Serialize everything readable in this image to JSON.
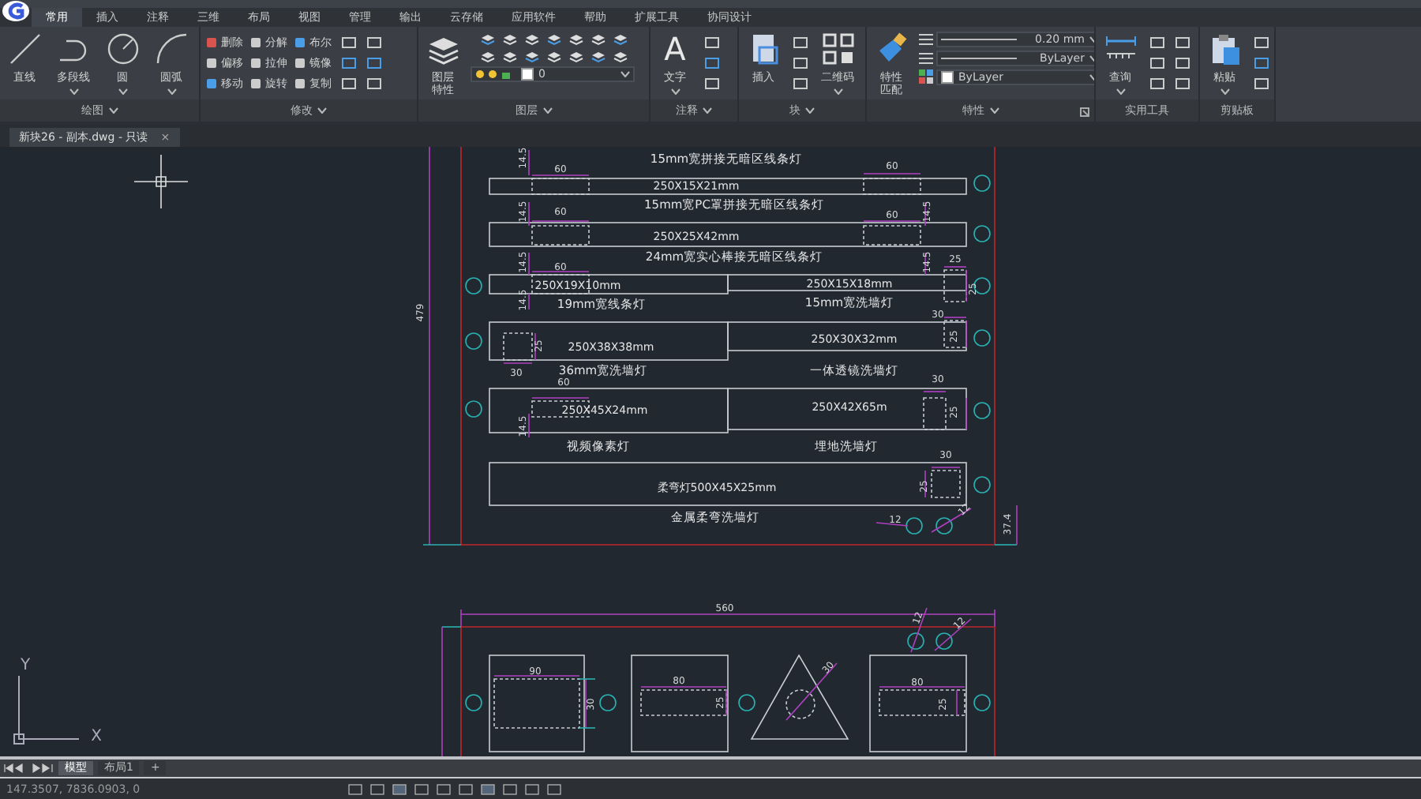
{
  "menu_tabs": [
    {
      "label": "常用",
      "selected": true
    },
    {
      "label": "插入",
      "selected": false
    },
    {
      "label": "注释",
      "selected": false
    },
    {
      "label": "三维",
      "selected": false
    },
    {
      "label": "布局",
      "selected": false
    },
    {
      "label": "视图",
      "selected": false
    },
    {
      "label": "管理",
      "selected": false
    },
    {
      "label": "输出",
      "selected": false
    },
    {
      "label": "云存储",
      "selected": false
    },
    {
      "label": "应用软件",
      "selected": false
    },
    {
      "label": "帮助",
      "selected": false
    },
    {
      "label": "扩展工具",
      "selected": false
    },
    {
      "label": "协同设计",
      "selected": false
    }
  ],
  "ribbon_panels": [
    {
      "title": "绘图",
      "menu": true,
      "tools": [
        {
          "kind": "large",
          "label": "直线",
          "menu": false
        },
        {
          "kind": "large",
          "label": "多段线",
          "menu": true
        },
        {
          "kind": "large",
          "label": "圆",
          "menu": true
        },
        {
          "kind": "large",
          "label": "圆弧",
          "menu": true
        }
      ]
    },
    {
      "title": "修改",
      "menu": true,
      "tools": [
        {
          "kind": "small",
          "label": "删除"
        },
        {
          "kind": "small",
          "label": "偏移"
        },
        {
          "kind": "small",
          "label": "移动"
        },
        {
          "kind": "small",
          "label": "分解"
        },
        {
          "kind": "small",
          "label": "拉伸"
        },
        {
          "kind": "small",
          "label": "旋转"
        },
        {
          "kind": "small",
          "label": "布尔"
        },
        {
          "kind": "small",
          "label": "镜像"
        },
        {
          "kind": "small",
          "label": "复制"
        }
      ]
    },
    {
      "title": "图层",
      "menu": true,
      "tools": [
        {
          "kind": "large",
          "label": "图层特性",
          "menu": false
        },
        {
          "kind": "combo",
          "value": "0"
        }
      ]
    },
    {
      "title": "注释",
      "menu": true,
      "tools": [
        {
          "kind": "large",
          "label": "文字",
          "glyph": "A",
          "menu": true
        }
      ]
    },
    {
      "title": "块",
      "menu": true,
      "tools": [
        {
          "kind": "large",
          "label": "插入",
          "menu": false
        },
        {
          "kind": "large",
          "label": "二维码",
          "menu": true
        }
      ]
    },
    {
      "title": "特性",
      "menu": true,
      "tools": [
        {
          "kind": "large",
          "label": "特性匹配",
          "menu": false
        },
        {
          "kind": "combo",
          "value": "0.20 mm"
        },
        {
          "kind": "combo",
          "value": "ByLayer"
        },
        {
          "kind": "combo",
          "value": "ByLayer"
        }
      ]
    },
    {
      "title": "实用工具",
      "menu": false,
      "tools": [
        {
          "kind": "large",
          "label": "查询",
          "menu": true
        }
      ]
    },
    {
      "title": "剪贴板",
      "menu": false,
      "tools": [
        {
          "kind": "large",
          "label": "粘贴",
          "menu": true
        }
      ]
    }
  ],
  "file_tab": {
    "title": "新块26 - 副本.dwg - 只读",
    "close": "×"
  },
  "drawing": {
    "labels": [
      {
        "kind": "dimension",
        "text": "479"
      },
      {
        "kind": "title",
        "text": "15mm宽拼接无暗区线条灯"
      },
      {
        "kind": "dimension",
        "text": "14.5"
      },
      {
        "kind": "dimension",
        "text": "60"
      },
      {
        "kind": "dimension",
        "text": "60"
      },
      {
        "kind": "size",
        "text": "250X15X21mm"
      },
      {
        "kind": "title",
        "text": "15mm宽PC罩拼接无暗区线条灯"
      },
      {
        "kind": "dimension",
        "text": "14.5"
      },
      {
        "kind": "dimension",
        "text": "60"
      },
      {
        "kind": "dimension",
        "text": "60"
      },
      {
        "kind": "dimension",
        "text": "14.5"
      },
      {
        "kind": "size",
        "text": "250X25X42mm"
      },
      {
        "kind": "title",
        "text": "24mm宽实心棒接无暗区线条灯"
      },
      {
        "kind": "dimension",
        "text": "14.5"
      },
      {
        "kind": "dimension",
        "text": "60"
      },
      {
        "kind": "dimension",
        "text": "14.5"
      },
      {
        "kind": "dimension",
        "text": "25"
      },
      {
        "kind": "size",
        "text": "250X19X10mm"
      },
      {
        "kind": "size",
        "text": "250X15X18mm"
      },
      {
        "kind": "dimension",
        "text": "25"
      },
      {
        "kind": "dimension",
        "text": "14.5"
      },
      {
        "kind": "title",
        "text": "19mm宽线条灯"
      },
      {
        "kind": "title",
        "text": "15mm宽洗墙灯"
      },
      {
        "kind": "dimension",
        "text": "30"
      },
      {
        "kind": "size",
        "text": "250X38X38mm"
      },
      {
        "kind": "dimension",
        "text": "25"
      },
      {
        "kind": "size",
        "text": "250X30X32mm"
      },
      {
        "kind": "dimension",
        "text": "25"
      },
      {
        "kind": "dimension",
        "text": "30"
      },
      {
        "kind": "title",
        "text": "36mm宽洗墙灯"
      },
      {
        "kind": "title",
        "text": "一体透镜洗墙灯"
      },
      {
        "kind": "dimension",
        "text": "60"
      },
      {
        "kind": "dimension",
        "text": "30"
      },
      {
        "kind": "size",
        "text": "250X45X24mm"
      },
      {
        "kind": "size",
        "text": "250X42X65m"
      },
      {
        "kind": "dimension",
        "text": "25"
      },
      {
        "kind": "dimension",
        "text": "14.5"
      },
      {
        "kind": "title",
        "text": "视频像素灯"
      },
      {
        "kind": "title",
        "text": "埋地洗墙灯"
      },
      {
        "kind": "dimension",
        "text": "30"
      },
      {
        "kind": "size",
        "text": "柔弯灯500X45X25mm"
      },
      {
        "kind": "dimension",
        "text": "25"
      },
      {
        "kind": "title",
        "text": "金属柔弯洗墙灯"
      },
      {
        "kind": "dimension",
        "text": "12"
      },
      {
        "kind": "dimension",
        "text": "12"
      },
      {
        "kind": "dimension",
        "text": "37.4"
      },
      {
        "kind": "dimension",
        "text": "560"
      },
      {
        "kind": "dimension",
        "text": "12"
      },
      {
        "kind": "dimension",
        "text": "12"
      },
      {
        "kind": "dimension",
        "text": "90"
      },
      {
        "kind": "dimension",
        "text": "30"
      },
      {
        "kind": "dimension",
        "text": "80"
      },
      {
        "kind": "dimension",
        "text": "25"
      },
      {
        "kind": "dimension",
        "text": "30"
      },
      {
        "kind": "dimension",
        "text": "80"
      },
      {
        "kind": "dimension",
        "text": "25"
      }
    ],
    "ucs": {
      "x_label": "X",
      "y_label": "Y"
    }
  },
  "layout_tabs": [
    {
      "label": "模型",
      "selected": true
    },
    {
      "label": "布局1",
      "selected": false
    },
    {
      "label": "+",
      "selected": false
    }
  ],
  "status_bar": {
    "coordinates": "147.3507, 7836.0903, 0"
  }
}
